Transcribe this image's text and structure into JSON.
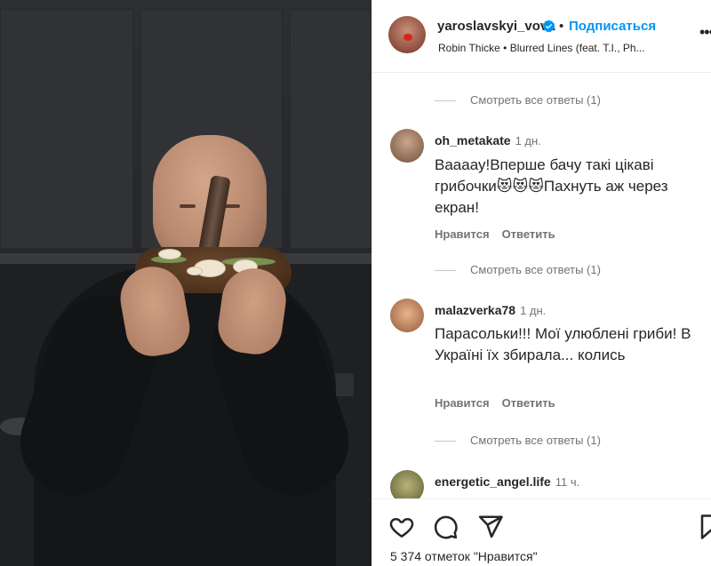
{
  "post": {
    "username": "yaroslavskyi_vova",
    "separator": "•",
    "follow_label": "Подписаться",
    "music": {
      "artist": "Robin Thicke",
      "separator": "•",
      "track": "Blurred Lines (feat. T.I., Ph..."
    },
    "verified_color": "#0095f6",
    "accent": "#0095f6"
  },
  "comments": [
    {
      "view_replies": "Смотреть все ответы (1)"
    },
    {
      "user": "oh_metakate",
      "time": "1 дн.",
      "text": "Ваааау!Вперше бачу такі цікаві грибочки😻😻😻Пахнуть аж через екран!",
      "like_label": "Нравится",
      "reply_label": "Ответить",
      "view_replies": "Смотреть все ответы (1)"
    },
    {
      "user": "malazverka78",
      "time": "1 дн.",
      "text": "Парасольки!!! Мої улюблені гриби! В Україні їх збирала... колись",
      "like_label": "Нравится",
      "reply_label": "Ответить",
      "view_replies": "Смотреть все ответы (1)"
    },
    {
      "user": "energetic_angel.life",
      "time": "11 ч."
    }
  ],
  "actions": {
    "like_icon": "heart-icon",
    "comment_icon": "comment-icon",
    "share_icon": "share-icon",
    "likes_text": "5 374 отметок \"Нравится\""
  }
}
